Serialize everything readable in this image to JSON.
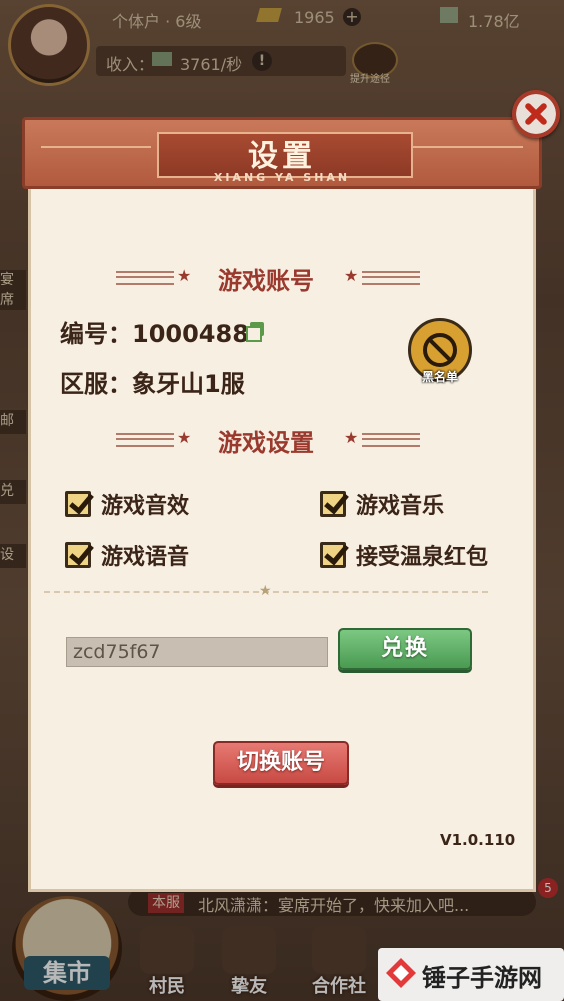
{
  "top_bar": {
    "player_title": "个体户 · 6级",
    "gold": "1965",
    "money": "1.78亿",
    "income_label": "收入：",
    "income_value": "3761/秒",
    "upgrade_label": "提升途径"
  },
  "left_side": [
    "宴席",
    "邮",
    "兑",
    "设"
  ],
  "chat": {
    "tag": "本服",
    "message": "北风潇潇：宴席开始了，快来加入吧...",
    "badge": "5"
  },
  "bottom_nav": {
    "market": "集市",
    "items": [
      "村民",
      "挚友",
      "合作社"
    ]
  },
  "watermark": "锤子手游网",
  "dialog": {
    "title": "设置",
    "subtitle": "XIANG YA SHAN",
    "account_section": "游戏账号",
    "id_label": "编号：1000488",
    "server_label": "区服：象牙山1服",
    "blacklist_label": "黑名单",
    "settings_section": "游戏设置",
    "options": [
      {
        "label": "游戏音效",
        "checked": true
      },
      {
        "label": "游戏音乐",
        "checked": true
      },
      {
        "label": "游戏语音",
        "checked": true
      },
      {
        "label": "接受温泉红包",
        "checked": true
      }
    ],
    "code_value": "zcd75f67",
    "redeem_button": "兑换",
    "switch_account_button": "切换账号",
    "version": "V1.0.110"
  }
}
